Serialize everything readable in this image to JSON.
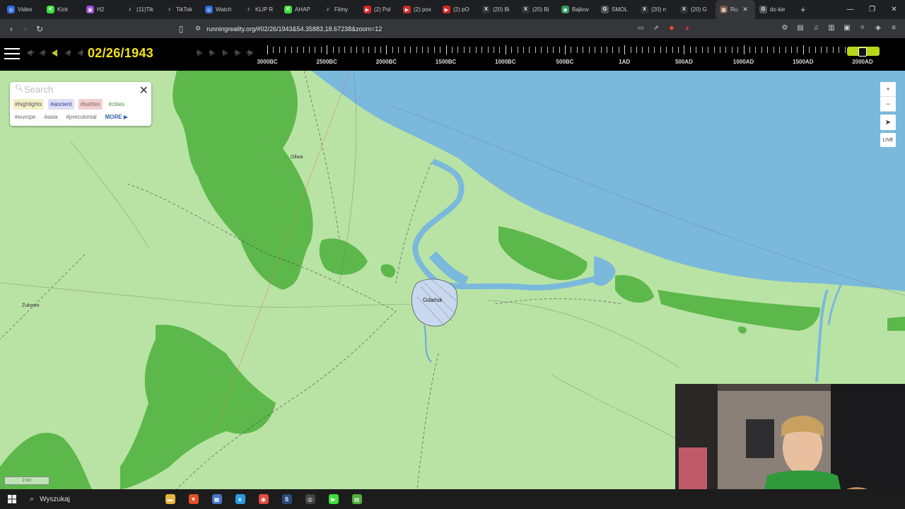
{
  "browser": {
    "tabs": [
      {
        "label": "Video",
        "color": "#2f6bdc",
        "glyph": "◎"
      },
      {
        "label": "Kick",
        "color": "#3be03b",
        "glyph": "K"
      },
      {
        "label": "H2",
        "color": "#9b4dd8",
        "glyph": "▣"
      },
      {
        "label": "(11)Tik",
        "color": "#222222",
        "glyph": "♪"
      },
      {
        "label": "TikTok",
        "color": "#222222",
        "glyph": "♪"
      },
      {
        "label": "Watch",
        "color": "#2f6bdc",
        "glyph": "◎"
      },
      {
        "label": "KLIP R",
        "color": "#222222",
        "glyph": "♪"
      },
      {
        "label": "AHAP",
        "color": "#3be03b",
        "glyph": "K"
      },
      {
        "label": "Filmy",
        "color": "#222222",
        "glyph": "♪"
      },
      {
        "label": "(2) Pol",
        "color": "#d42a2a",
        "glyph": "▶"
      },
      {
        "label": "(2) pox",
        "color": "#d42a2a",
        "glyph": "▶"
      },
      {
        "label": "(2) pO",
        "color": "#d42a2a",
        "glyph": "▶"
      },
      {
        "label": "(20) Bi",
        "color": "#333333",
        "glyph": "X"
      },
      {
        "label": "(20) Bi",
        "color": "#333333",
        "glyph": "X"
      },
      {
        "label": "Bajkov",
        "color": "#2f9c5b",
        "glyph": "◉"
      },
      {
        "label": "SMOL",
        "color": "#555555",
        "glyph": "G"
      },
      {
        "label": "(20) n",
        "color": "#333333",
        "glyph": "X"
      },
      {
        "label": "(20) G",
        "color": "#333333",
        "glyph": "X"
      },
      {
        "label": "Ru",
        "color": "#7a5a4a",
        "glyph": "▦",
        "active": true
      },
      {
        "label": "do kie",
        "color": "#555555",
        "glyph": "G"
      }
    ],
    "new_tab": "+",
    "url": "runningreality.org/#02/26/1943&54.35883,18.67238&zoom=12",
    "window_controls": [
      "—",
      "❐",
      "✕"
    ]
  },
  "timeline": {
    "date": "02/26/1943",
    "back_steps": [
      "100",
      "10",
      "Y",
      "M",
      "D"
    ],
    "fwd_steps": [
      "D",
      "M",
      "Y",
      "10",
      "100"
    ],
    "ruler_labels": [
      "3000BC",
      "2500BC",
      "2000BC",
      "1500BC",
      "1000BC",
      "500BC",
      "1AD",
      "500AD",
      "1000AD",
      "1500AD",
      "2000AD"
    ]
  },
  "search": {
    "placeholder": "Search",
    "tags": [
      {
        "label": "#highlights",
        "bg": "#f3f0c8",
        "color": "#555555"
      },
      {
        "label": "#ancient",
        "bg": "#dde0f3",
        "color": "#333399"
      },
      {
        "label": "#battles",
        "bg": "#f2d0d0",
        "color": "#886666"
      },
      {
        "label": "#cities",
        "bg": "#ffffff",
        "color": "#4a8a3a"
      },
      {
        "label": "#europe",
        "bg": "#ffffff",
        "color": "#666666"
      },
      {
        "label": "#asia",
        "bg": "#ffffff",
        "color": "#666666"
      },
      {
        "label": "#precolonial",
        "bg": "#ffffff",
        "color": "#666666"
      },
      {
        "label": "MORE ▶",
        "bg": "#ffffff",
        "color": "#3366aa"
      }
    ]
  },
  "map": {
    "labels": {
      "city": "Gdańsk",
      "oliwa": "Oliwa",
      "zukowo": "Żukowo"
    },
    "zoom_in": "+",
    "zoom_out": "−",
    "locate": "➤",
    "live": "LIVE",
    "scale": "2 km",
    "colors": {
      "land": "#b9e3a4",
      "forest": "#5cb84a",
      "water": "#7ab9dc",
      "river": "#6aa9d8"
    }
  },
  "taskbar": {
    "search_label": "Wyszukaj",
    "apps": [
      {
        "name": "file-explorer",
        "color": "#e8b53c",
        "glyph": "▬"
      },
      {
        "name": "brave",
        "color": "#e2502a",
        "glyph": "▼"
      },
      {
        "name": "store",
        "color": "#4a74c6",
        "glyph": "▦"
      },
      {
        "name": "edge",
        "color": "#2b9be0",
        "glyph": "e"
      },
      {
        "name": "chrome",
        "color": "#e24a3a",
        "glyph": "◉"
      },
      {
        "name": "steam",
        "color": "#2a4a78",
        "glyph": "S"
      },
      {
        "name": "obs",
        "color": "#444444",
        "glyph": "◎"
      },
      {
        "name": "play",
        "color": "#3be03b",
        "glyph": "▶"
      },
      {
        "name": "app",
        "color": "#4fae3a",
        "glyph": "▤"
      }
    ]
  }
}
